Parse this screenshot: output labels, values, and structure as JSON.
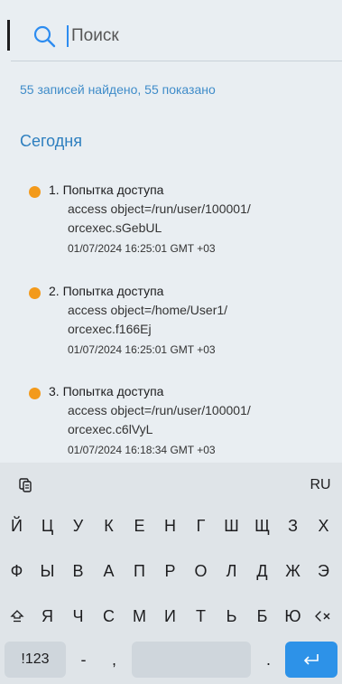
{
  "search": {
    "placeholder": "Поиск"
  },
  "results": {
    "summary": "55 записей найдено, 55 показано"
  },
  "section": {
    "title": "Сегодня"
  },
  "entries": [
    {
      "title": "1. Попытка доступа",
      "line1": "access object=/run/user/100001/",
      "line2": "orcexec.sGebUL",
      "time": "01/07/2024 16:25:01 GMT +03",
      "dot_color": "#f39a1b"
    },
    {
      "title": "2. Попытка доступа",
      "line1": "access object=/home/User1/",
      "line2": "orcexec.f166Ej",
      "time": "01/07/2024 16:25:01 GMT +03",
      "dot_color": "#f39a1b"
    },
    {
      "title": "3. Попытка доступа",
      "line1": "access object=/run/user/100001/",
      "line2": "orcexec.c6lVyL",
      "time": "01/07/2024 16:18:34 GMT +03",
      "dot_color": "#f39a1b"
    }
  ],
  "keyboard": {
    "clipboard_icon": "clipboard-icon",
    "language": "RU",
    "row1": [
      "Й",
      "Ц",
      "У",
      "К",
      "Е",
      "Н",
      "Г",
      "Ш",
      "Щ",
      "З",
      "Х"
    ],
    "row2": [
      "Ф",
      "Ы",
      "В",
      "А",
      "П",
      "Р",
      "О",
      "Л",
      "Д",
      "Ж",
      "Э"
    ],
    "row3": [
      "Я",
      "Ч",
      "С",
      "М",
      "И",
      "Т",
      "Ь",
      "Б",
      "Ю"
    ],
    "shift_icon": "shift-icon",
    "backspace_icon": "backspace-icon",
    "symbols": "!123",
    "dash": "-",
    "comma": ",",
    "period": ".",
    "enter_icon": "enter-icon"
  },
  "colors": {
    "accent": "#2e7fbf",
    "background": "#e9eef2",
    "warning_dot": "#f39a1b",
    "enter_key": "#2d92e8"
  }
}
